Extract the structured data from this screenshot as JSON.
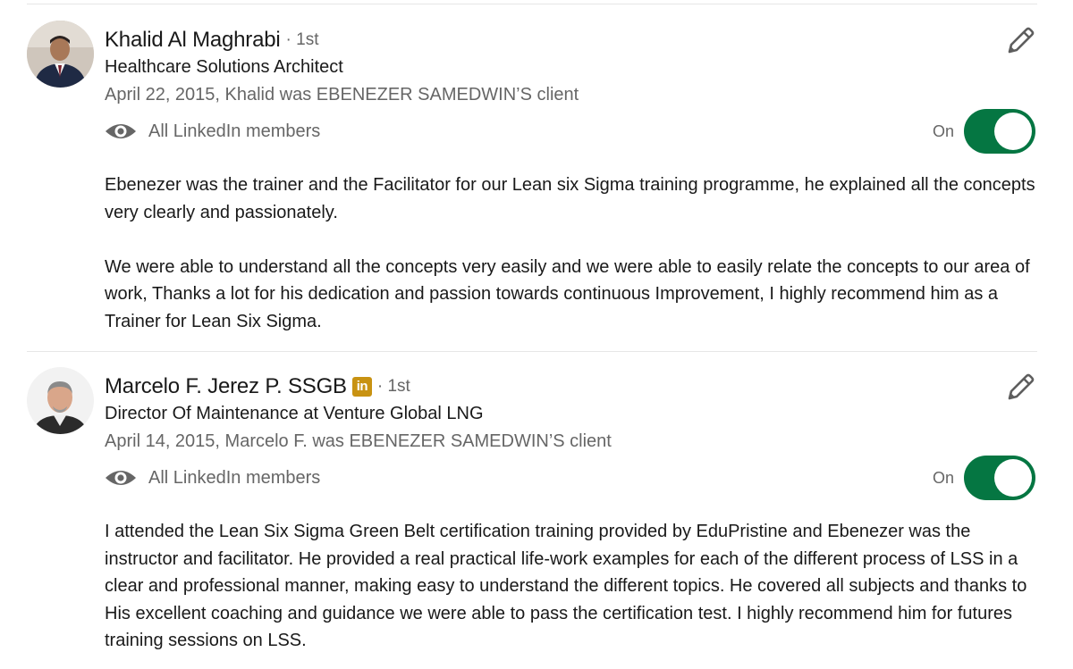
{
  "colors": {
    "toggle_on": "#057642",
    "badge": "#c89212",
    "secondary_text": "#666666",
    "divider": "#e6e6e6"
  },
  "recommendations": [
    {
      "name": "Khalid Al Maghrabi",
      "badge": "",
      "degree": "· 1st",
      "headline": "Healthcare Solutions Architect",
      "relation": "April 22, 2015, Khalid was EBENEZER SAMEDWIN’S client",
      "visibility_icon": "eye-icon",
      "visibility": "All LinkedIn members",
      "toggle_label": "On",
      "toggle_on": true,
      "edit_icon": "pencil-icon",
      "paragraphs": [
        "Ebenezer was the trainer and the Facilitator for our Lean six Sigma training programme, he explained all the concepts very clearly and passionately.",
        "We were able to understand all the concepts very easily and we were able to easily relate the concepts to our area of work, Thanks a lot for his dedication and passion towards continuous Improvement, I highly recommend him as a Trainer for Lean Six Sigma."
      ]
    },
    {
      "name": "Marcelo F. Jerez P. SSGB",
      "badge": "in",
      "degree": "· 1st",
      "headline": "Director Of Maintenance at Venture Global LNG",
      "relation": "April 14, 2015, Marcelo F. was EBENEZER SAMEDWIN’S client",
      "visibility_icon": "eye-icon",
      "visibility": "All LinkedIn members",
      "toggle_label": "On",
      "toggle_on": true,
      "edit_icon": "pencil-icon",
      "paragraphs": [
        "I attended the Lean Six Sigma Green Belt certification training provided by EduPristine and Ebenezer was the instructor and facilitator. He provided a real practical life-work examples for each of the different process of LSS in a clear and professional manner, making easy to understand the different topics. He covered all subjects and thanks to His excellent coaching and guidance we were able to pass the certification test. I highly recommend him for futures training sessions on LSS."
      ]
    }
  ]
}
